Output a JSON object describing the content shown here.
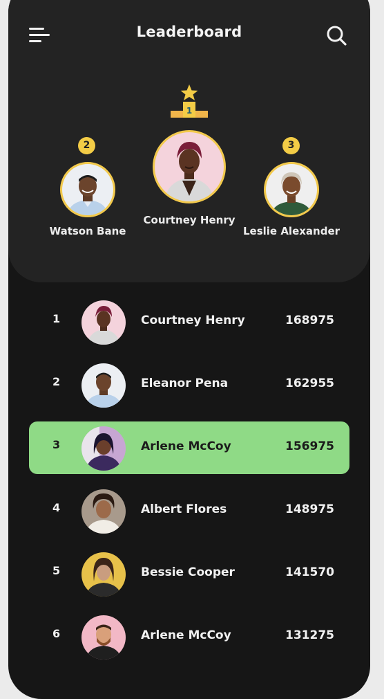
{
  "header": {
    "title": "Leaderboard",
    "menu_icon": "menu-icon",
    "search_icon": "search-icon"
  },
  "podium": {
    "first": {
      "rank": "1",
      "name": "Courtney Henry",
      "icon": "trophy-star-icon"
    },
    "second": {
      "rank": "2",
      "name": "Watson Bane"
    },
    "third": {
      "rank": "3",
      "name": "Leslie Alexander"
    }
  },
  "leaderboard": [
    {
      "rank": "1",
      "name": "Courtney Henry",
      "score": "168975"
    },
    {
      "rank": "2",
      "name": "Eleanor Pena",
      "score": "162955"
    },
    {
      "rank": "3",
      "name": "Arlene McCoy",
      "score": "156975",
      "highlighted": true
    },
    {
      "rank": "4",
      "name": "Albert Flores",
      "score": "148975"
    },
    {
      "rank": "5",
      "name": "Bessie Cooper",
      "score": "141570"
    },
    {
      "rank": "6",
      "name": "Arlene McCoy",
      "score": "131275"
    }
  ],
  "colors": {
    "background": "#161616",
    "panel": "#232323",
    "accent_gold": "#f3cc46",
    "highlight_green": "#8fda86"
  }
}
